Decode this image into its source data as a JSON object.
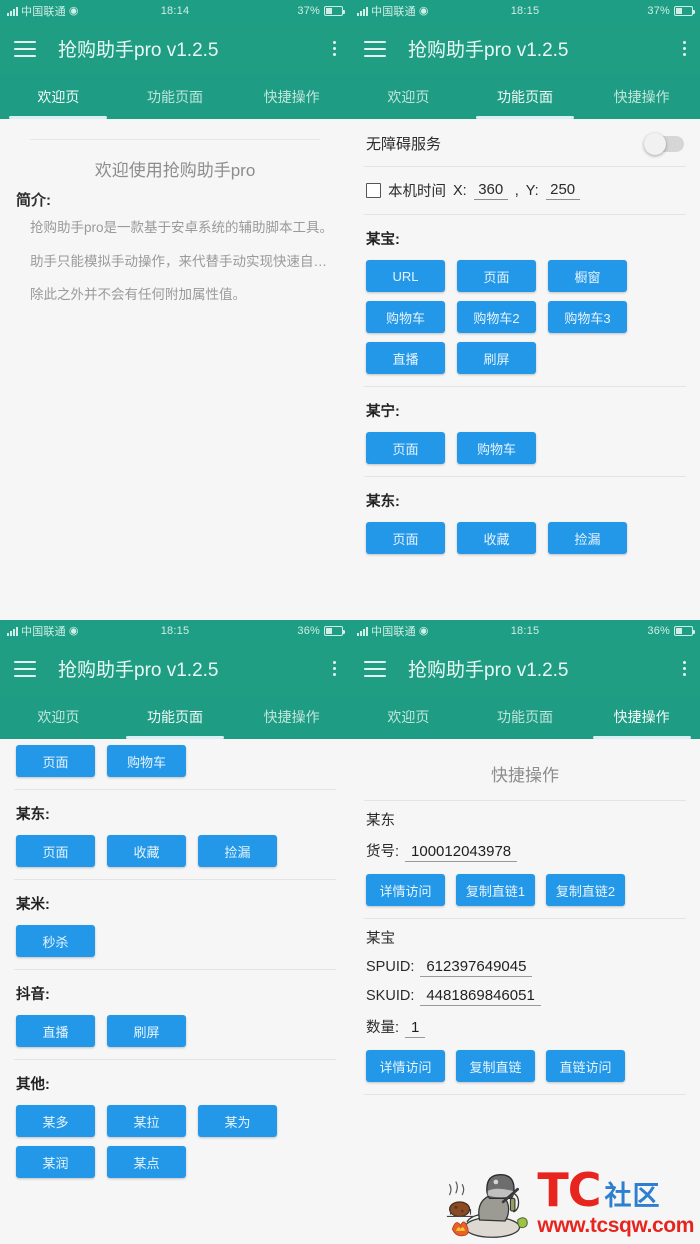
{
  "app": {
    "title": "抢购助手pro v1.2.5",
    "accent_header": "#209e84",
    "accent_button": "#2398e8"
  },
  "tabs": [
    "欢迎页",
    "功能页面",
    "快捷操作"
  ],
  "panels": {
    "top_left": {
      "status": {
        "carrier": "中国联通",
        "time": "18:14",
        "battery": "37%"
      },
      "active_tab": 0,
      "welcome": {
        "title": "欢迎使用抢购助手pro",
        "intro_label": "简介:",
        "paragraphs": [
          "抢购助手pro是一款基于安卓系统的辅助脚本工具。",
          "助手只能模拟手动操作，来代替手动实现快速自…",
          "除此之外并不会有任何附加属性值。"
        ]
      }
    },
    "top_right": {
      "status": {
        "carrier": "中国联通",
        "time": "18:15",
        "battery": "37%"
      },
      "active_tab": 1,
      "service": {
        "label": "无障碍服务",
        "enabled": false
      },
      "coord": {
        "checkbox_label": "本机时间",
        "checked": false,
        "x_label": "X:",
        "x_value": "360",
        "comma": ",",
        "y_label": "Y:",
        "y_value": "250"
      },
      "sections": [
        {
          "title": "某宝:",
          "buttons": [
            "URL",
            "页面",
            "橱窗",
            "购物车",
            "购物车2",
            "购物车3",
            "直播",
            "刷屏"
          ]
        },
        {
          "title": "某宁:",
          "buttons": [
            "页面",
            "购物车"
          ]
        },
        {
          "title": "某东:",
          "buttons": [
            "页面",
            "收藏",
            "捡漏"
          ]
        }
      ]
    },
    "bottom_left": {
      "status": {
        "carrier": "中国联通",
        "time": "18:15",
        "battery": "36%"
      },
      "active_tab": 1,
      "partial_buttons": [
        "页面",
        "购物车"
      ],
      "sections": [
        {
          "title": "某东:",
          "buttons": [
            "页面",
            "收藏",
            "捡漏"
          ]
        },
        {
          "title": "某米:",
          "buttons": [
            "秒杀"
          ]
        },
        {
          "title": "抖音:",
          "buttons": [
            "直播",
            "刷屏"
          ]
        },
        {
          "title": "其他:",
          "buttons": [
            "某多",
            "某拉",
            "某为",
            "某润",
            "某点"
          ]
        }
      ]
    },
    "bottom_right": {
      "status": {
        "carrier": "中国联通",
        "time": "18:15",
        "battery": "36%"
      },
      "active_tab": 2,
      "page_title": "快捷操作",
      "group_jd": {
        "name": "某东",
        "field_label": "货号:",
        "field_value": "100012043978",
        "buttons": [
          "详情访问",
          "复制直链1",
          "复制直链2"
        ]
      },
      "group_tb": {
        "name": "某宝",
        "spuid_label": "SPUID:",
        "spuid_value": "612397649045",
        "skuid_label": "SKUID:",
        "skuid_value": "4481869846051",
        "qty_label": "数量:",
        "qty_value": "1",
        "buttons": [
          "详情访问",
          "复制直链",
          "直链访问"
        ]
      },
      "watermark": {
        "brand": "TC",
        "community": "社区",
        "url": "www.tcsqw.com"
      }
    }
  }
}
